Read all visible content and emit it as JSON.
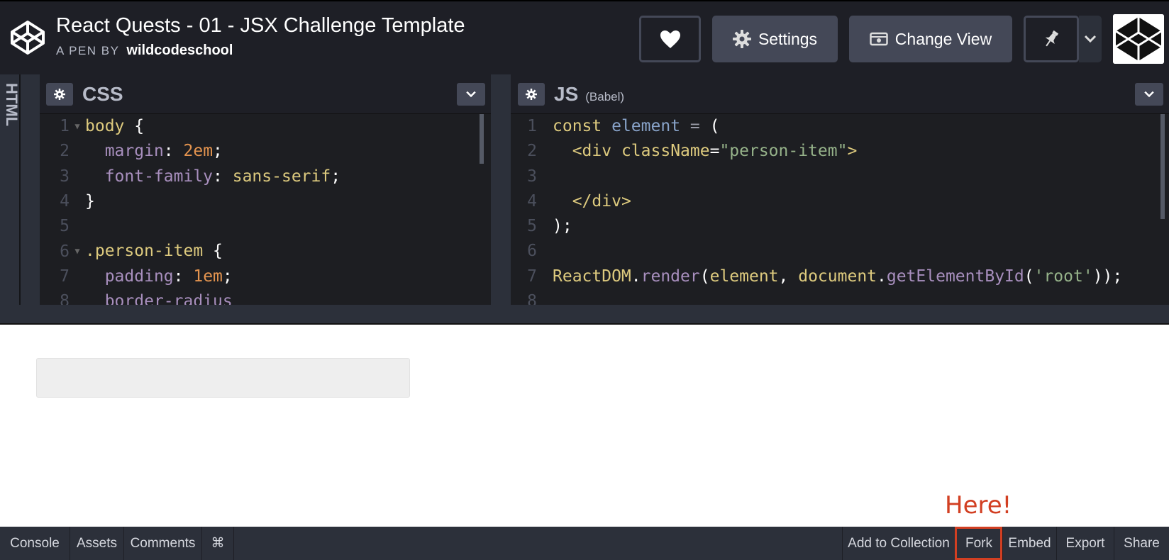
{
  "header": {
    "title": "React Quests - 01 - JSX Challenge Template",
    "byline_prefix": "A PEN BY",
    "author": "wildcodeschool",
    "settings_label": "Settings",
    "change_view_label": "Change View"
  },
  "editors": {
    "html_tab": "HTML",
    "css": {
      "title": "CSS",
      "lines": [
        {
          "n": "1",
          "fold": true
        },
        {
          "n": "2"
        },
        {
          "n": "3"
        },
        {
          "n": "4"
        },
        {
          "n": "5"
        },
        {
          "n": "6",
          "fold": true
        },
        {
          "n": "7"
        },
        {
          "n": "8"
        }
      ],
      "code": {
        "l1_sel": "body",
        "l1_brace": " {",
        "l2_prop": "margin",
        "l2_val": "2em",
        "l3_prop": "font-family",
        "l3_val": "sans-serif",
        "l4": "}",
        "l6_sel": ".person-item",
        "l6_brace": " {",
        "l7_prop": "padding",
        "l7_val": "1em",
        "l8_prop": "border-radius"
      }
    },
    "js": {
      "title": "JS",
      "subtitle": "(Babel)",
      "lines": [
        "1",
        "2",
        "3",
        "4",
        "5",
        "6",
        "7",
        "8"
      ],
      "code": {
        "l1_kw": "const",
        "l1_var": "element",
        "l1_eq": " = ",
        "l1_paren": "(",
        "l2_tag_open": "<div",
        "l2_attr": "className",
        "l2_str": "\"person-item\"",
        "l2_close": ">",
        "l4_tag": "</div>",
        "l5": ");",
        "l7_obj": "ReactDOM",
        "l7_method": "render",
        "l7_arg1": "element",
        "l7_doc": "document",
        "l7_method2": "getElementById",
        "l7_str": "'root'",
        "l7_end": "));"
      }
    }
  },
  "annotation": {
    "text": "Here!",
    "color": "#d23f22"
  },
  "footer": {
    "left": [
      "Console",
      "Assets",
      "Comments",
      "⌘"
    ],
    "right": [
      "Add to Collection",
      "Fork",
      "Embed",
      "Export",
      "Share"
    ]
  },
  "colors": {
    "topbar": "#1e1f26",
    "button": "#444857",
    "editor_bg": "#1d1e22",
    "highlight": "#d23f22"
  }
}
